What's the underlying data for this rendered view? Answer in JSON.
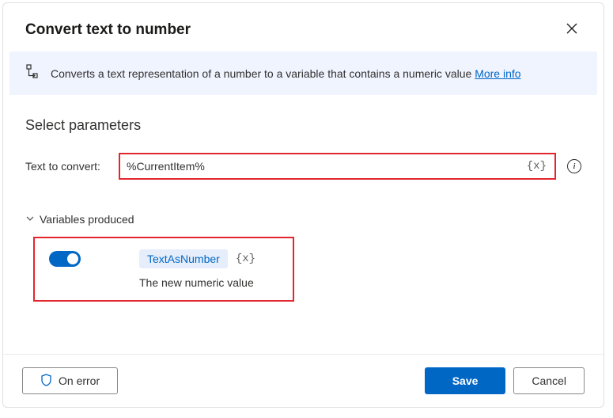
{
  "dialog": {
    "title": "Convert text to number"
  },
  "banner": {
    "text": "Converts a text representation of a number to a variable that contains a numeric value ",
    "link": "More info"
  },
  "parameters": {
    "section_title": "Select parameters",
    "text_to_convert_label": "Text to convert:",
    "text_to_convert_value": "%CurrentItem%"
  },
  "variables": {
    "header": "Variables produced",
    "output_name": "TextAsNumber",
    "output_desc": "The new numeric value",
    "var_token": "{x}"
  },
  "footer": {
    "on_error": "On error",
    "save": "Save",
    "cancel": "Cancel"
  }
}
